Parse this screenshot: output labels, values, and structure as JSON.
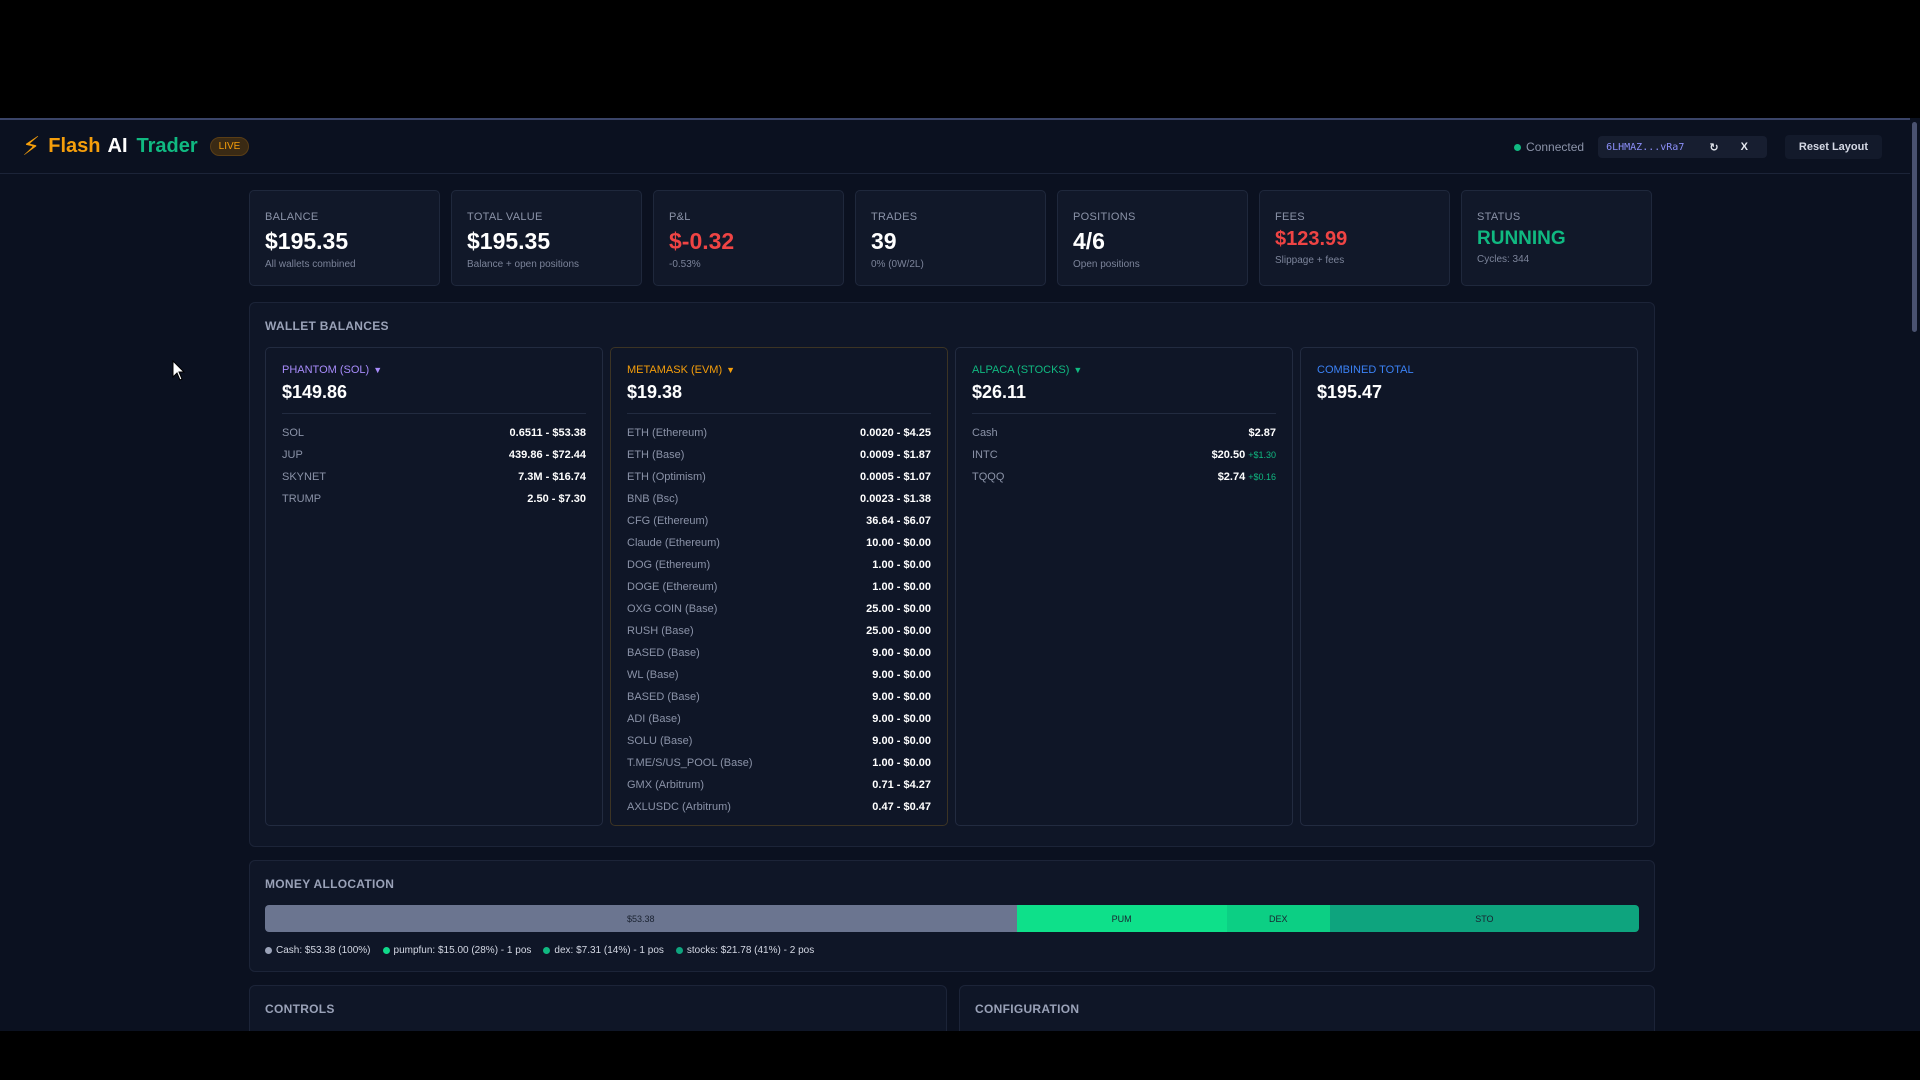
{
  "header": {
    "brand_flash": "Flash",
    "brand_ai": "AI",
    "brand_trader": "Trader",
    "live": "LIVE",
    "connection": "Connected",
    "wallet_address": "6LHMAZ...vRa7",
    "refresh_icon": "↻",
    "disconnect": "X",
    "reset_layout": "Reset Layout"
  },
  "stats": [
    {
      "label": "BALANCE",
      "value": "$195.35",
      "sub": "All wallets combined"
    },
    {
      "label": "TOTAL VALUE",
      "value": "$195.35",
      "sub": "Balance + open positions"
    },
    {
      "label": "P&L",
      "value": "$-0.32",
      "sub": "-0.53%"
    },
    {
      "label": "TRADES",
      "value": "39",
      "sub": "0% (0W/2L)"
    },
    {
      "label": "POSITIONS",
      "value": "4/6",
      "sub": "Open positions"
    },
    {
      "label": "FEES",
      "value": "$123.99",
      "sub": "Slippage + fees"
    },
    {
      "label": "STATUS",
      "value": "RUNNING",
      "sub": "Cycles: 344"
    }
  ],
  "wallets": {
    "title": "WALLET BALANCES",
    "phantom": {
      "name": "PHANTOM (SOL)",
      "caret": "▼",
      "total": "$149.86",
      "rows": [
        {
          "asset": "SOL",
          "amount": "0.6511 - $53.38"
        },
        {
          "asset": "JUP",
          "amount": "439.86 - $72.44"
        },
        {
          "asset": "SKYNET",
          "amount": "7.3M - $16.74"
        },
        {
          "asset": "TRUMP",
          "amount": "2.50 - $7.30"
        }
      ]
    },
    "metamask": {
      "name": "METAMASK (EVM)",
      "caret": "▼",
      "total": "$19.38",
      "rows": [
        {
          "asset": "ETH (Ethereum)",
          "amount": "0.0020 - $4.25"
        },
        {
          "asset": "ETH (Base)",
          "amount": "0.0009 - $1.87"
        },
        {
          "asset": "ETH (Optimism)",
          "amount": "0.0005 - $1.07"
        },
        {
          "asset": "BNB (Bsc)",
          "amount": "0.0023 - $1.38"
        },
        {
          "asset": "CFG (Ethereum)",
          "amount": "36.64 - $6.07"
        },
        {
          "asset": "Claude (Ethereum)",
          "amount": "10.00 - $0.00"
        },
        {
          "asset": "DOG (Ethereum)",
          "amount": "1.00 - $0.00"
        },
        {
          "asset": "DOGE (Ethereum)",
          "amount": "1.00 - $0.00"
        },
        {
          "asset": "OXG COIN (Base)",
          "amount": "25.00 - $0.00"
        },
        {
          "asset": "RUSH (Base)",
          "amount": "25.00 - $0.00"
        },
        {
          "asset": "BASED (Base)",
          "amount": "9.00 - $0.00"
        },
        {
          "asset": "WL (Base)",
          "amount": "9.00 - $0.00"
        },
        {
          "asset": "BASED (Base)",
          "amount": "9.00 - $0.00"
        },
        {
          "asset": "ADI (Base)",
          "amount": "9.00 - $0.00"
        },
        {
          "asset": "SOLU (Base)",
          "amount": "9.00 - $0.00"
        },
        {
          "asset": "T.ME/S/US_POOL (Base)",
          "amount": "1.00 - $0.00"
        },
        {
          "asset": "GMX (Arbitrum)",
          "amount": "0.71 - $4.27"
        },
        {
          "asset": "AXLUSDC (Arbitrum)",
          "amount": "0.47 - $0.47"
        }
      ]
    },
    "alpaca": {
      "name": "ALPACA (STOCKS)",
      "caret": "▼",
      "total": "$26.11",
      "rows": [
        {
          "asset": "Cash",
          "amount": "$2.87",
          "change": ""
        },
        {
          "asset": "INTC",
          "amount": "$20.50",
          "change": "+$1.30"
        },
        {
          "asset": "TQQQ",
          "amount": "$2.74",
          "change": "+$0.16"
        }
      ]
    },
    "combined": {
      "name": "COMBINED TOTAL",
      "total": "$195.47"
    }
  },
  "allocation": {
    "title": "MONEY ALLOCATION",
    "segments": [
      {
        "label": "$53.38",
        "fraction": 0.547,
        "color": "#6b7590"
      },
      {
        "label": "PUM",
        "fraction": 0.153,
        "color": "#0ee08a"
      },
      {
        "label": "DEX",
        "fraction": 0.075,
        "color": "#0ccf84"
      },
      {
        "label": "STO",
        "fraction": 0.225,
        "color": "#0ea47e"
      }
    ],
    "legend": [
      {
        "text": "Cash: $53.38 (100%)",
        "color": "#9aa2b8"
      },
      {
        "text": "pumpfun: $15.00 (28%) - 1 pos",
        "color": "#10d98a"
      },
      {
        "text": "dex: $7.31 (14%) - 1 pos",
        "color": "#10b981"
      },
      {
        "text": "stocks: $21.78 (41%) - 2 pos",
        "color": "#0ea47e"
      }
    ]
  },
  "controls": {
    "title": "CONTROLS"
  },
  "configuration": {
    "title": "CONFIGURATION"
  },
  "colors": {
    "accent_orange": "#f59e0b",
    "accent_green": "#10b981",
    "negative": "#ef4444",
    "background": "#0b1120"
  }
}
